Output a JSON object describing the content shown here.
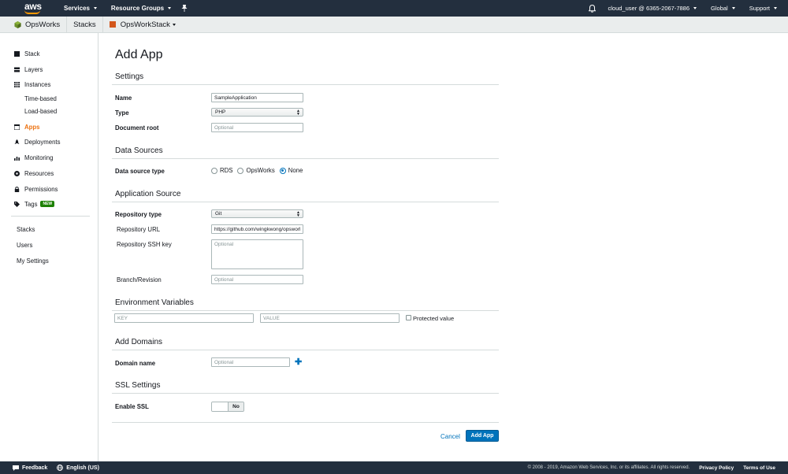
{
  "topnav": {
    "logo_text": "aws",
    "services": "Services",
    "resource_groups": "Resource Groups",
    "account": "cloud_user @ 6365-2067-7886",
    "region": "Global",
    "support": "Support"
  },
  "breadcrumb": {
    "service": "OpsWorks",
    "stacks": "Stacks",
    "stack": "OpsWorkStack"
  },
  "sidebar": {
    "items": [
      {
        "label": "Stack",
        "icon": "stack-icon"
      },
      {
        "label": "Layers",
        "icon": "layers-icon"
      },
      {
        "label": "Instances",
        "icon": "instances-icon"
      },
      {
        "label": "Time-based"
      },
      {
        "label": "Load-based"
      },
      {
        "label": "Apps",
        "icon": "apps-icon"
      },
      {
        "label": "Deployments",
        "icon": "deployments-icon"
      },
      {
        "label": "Monitoring",
        "icon": "monitoring-icon"
      },
      {
        "label": "Resources",
        "icon": "resources-icon"
      },
      {
        "label": "Permissions",
        "icon": "lock-icon"
      },
      {
        "label": "Tags",
        "icon": "tag-icon",
        "badge": "NEW"
      }
    ],
    "global": [
      "Stacks",
      "Users",
      "My Settings"
    ]
  },
  "main": {
    "title": "Add App",
    "settings": {
      "heading": "Settings",
      "name_label": "Name",
      "name_value": "SampleApplication",
      "type_label": "Type",
      "type_value": "PHP",
      "docroot_label": "Document root",
      "docroot_placeholder": "Optional"
    },
    "data_sources": {
      "heading": "Data Sources",
      "type_label": "Data source type",
      "options": [
        "RDS",
        "OpsWorks",
        "None"
      ],
      "selected": "None"
    },
    "app_source": {
      "heading": "Application Source",
      "repo_type_label": "Repository type",
      "repo_type_value": "Git",
      "repo_url_label": "Repository URL",
      "repo_url_value": "https://github.com/wingkwong/opsworks",
      "ssh_key_label": "Repository SSH key",
      "ssh_key_placeholder": "Optional",
      "branch_label": "Branch/Revision",
      "branch_placeholder": "Optional"
    },
    "env_vars": {
      "heading": "Environment Variables",
      "key_placeholder": "KEY",
      "value_placeholder": "VALUE",
      "protected_label": "Protected value"
    },
    "domains": {
      "heading": "Add Domains",
      "label": "Domain name",
      "placeholder": "Optional"
    },
    "ssl": {
      "heading": "SSL Settings",
      "label": "Enable SSL",
      "value": "No"
    },
    "actions": {
      "cancel": "Cancel",
      "submit": "Add App"
    }
  },
  "footer": {
    "feedback": "Feedback",
    "language": "English (US)",
    "copyright": "© 2008 - 2019, Amazon Web Services, Inc. or its affiliates. All rights reserved.",
    "privacy": "Privacy Policy",
    "terms": "Terms of Use"
  }
}
